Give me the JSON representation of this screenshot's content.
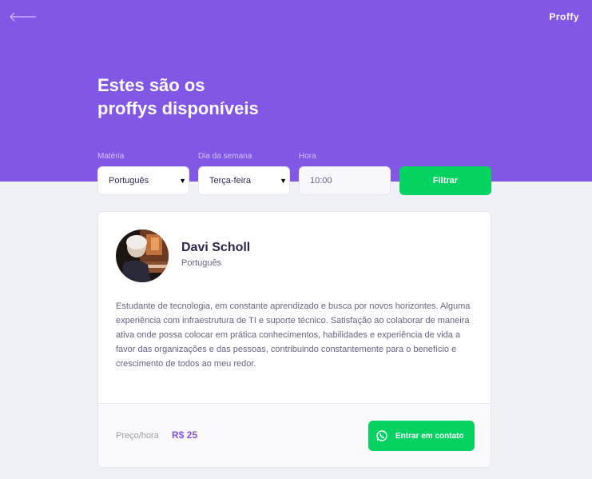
{
  "header": {
    "logo": "Proffy",
    "title_line1": "Estes são os",
    "title_line2": "proffys disponíveis",
    "back_icon": "arrow-left-icon"
  },
  "filters": {
    "subject_label": "Matéria",
    "subject_value": "Português",
    "weekday_label": "Dia da semana",
    "weekday_value": "Terça-feira",
    "time_label": "Hora",
    "time_value": "10:00",
    "submit_label": "Filtrar"
  },
  "teacher": {
    "name": "Davi Scholl",
    "subject": "Português",
    "bio": "Estudante de tecnologia, em constante aprendizado e busca por novos horizontes. Alguma experiência com infraestrutura de TI e suporte técnico. Satisfação ao colaborar de maneira ativa onde possa colocar em prática conhecimentos, habilidades e experiência de vida a favor das organizações e das pessoas, contribuindo constantemente para o benefício e crescimento de todos ao meu redor.",
    "price_label": "Preço/hora",
    "price_value": "R$ 25",
    "contact_label": "Entrar em contato",
    "contact_icon": "whatsapp-icon"
  },
  "colors": {
    "primary": "#8257e5",
    "secondary": "#04d361",
    "background": "#f0f0f7",
    "text_title": "#32264d",
    "text_base": "#6a6180"
  }
}
